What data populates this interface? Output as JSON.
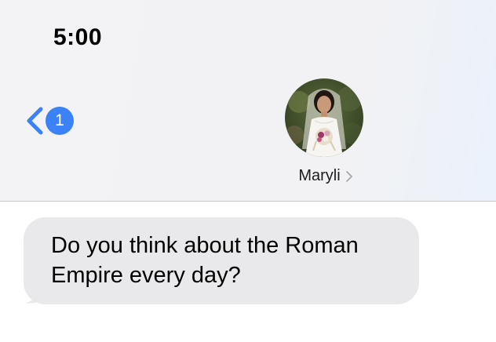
{
  "status_bar": {
    "time": "5:00"
  },
  "nav": {
    "unread_count": "1",
    "contact_name": "Maryli"
  },
  "icons": {
    "back": "chevron-left-icon",
    "contact_detail": "chevron-right-icon"
  },
  "colors": {
    "accent": "#3b82f6",
    "incoming_bubble": "#e9e9eb",
    "header_bg": "#f2f2f4"
  },
  "messages": [
    {
      "direction": "incoming",
      "text": "Do you think about the Roman Empire every day?"
    }
  ]
}
